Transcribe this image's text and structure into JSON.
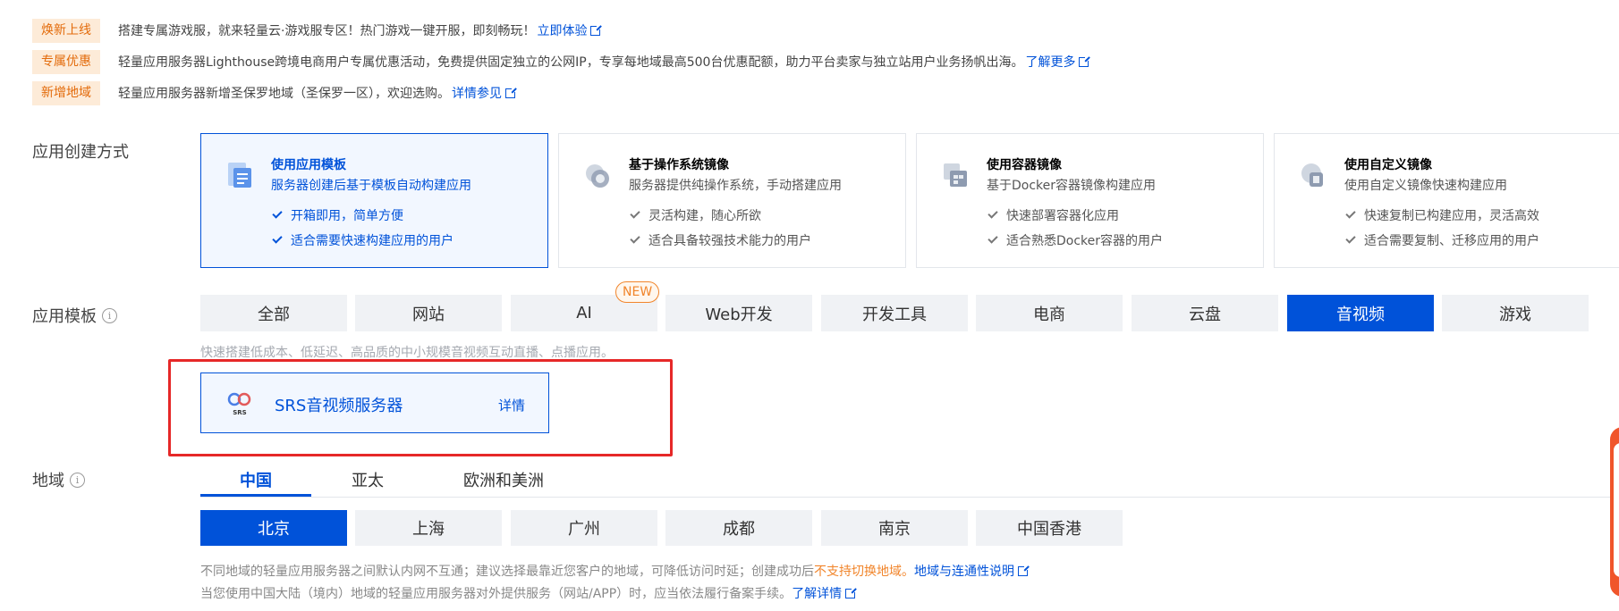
{
  "notices": [
    {
      "tag": "焕新上线",
      "text": "搭建专属游戏服，就来轻量云·游戏服专区！热门游戏一键开服，即刻畅玩！",
      "link": "立即体验"
    },
    {
      "tag": "专属优惠",
      "text": "轻量应用服务器Lighthouse跨境电商用户专属优惠活动，免费提供固定独立的公网IP，专享每地域最高500台优惠配额，助力平台卖家与独立站用户业务扬帆出海。",
      "link": "了解更多"
    },
    {
      "tag": "新增地域",
      "text": "轻量应用服务器新增圣保罗地域（圣保罗一区），欢迎选购。",
      "link": "详情参见"
    }
  ],
  "creation": {
    "label": "应用创建方式",
    "cards": [
      {
        "title": "使用应用模板",
        "desc": "服务器创建后基于模板自动构建应用",
        "features": [
          "开箱即用，简单方便",
          "适合需要快速构建应用的用户"
        ],
        "selected": true
      },
      {
        "title": "基于操作系统镜像",
        "desc": "服务器提供纯操作系统，手动搭建应用",
        "features": [
          "灵活构建，随心所欲",
          "适合具备较强技术能力的用户"
        ],
        "selected": false
      },
      {
        "title": "使用容器镜像",
        "desc": "基于Docker容器镜像构建应用",
        "features": [
          "快速部署容器化应用",
          "适合熟悉Docker容器的用户"
        ],
        "selected": false
      },
      {
        "title": "使用自定义镜像",
        "desc": "使用自定义镜像快速构建应用",
        "features": [
          "快速复制已构建应用，灵活高效",
          "适合需要复制、迁移应用的用户"
        ],
        "selected": false
      }
    ]
  },
  "templates": {
    "label": "应用模板",
    "tabs": [
      "全部",
      "网站",
      "AI",
      "Web开发",
      "开发工具",
      "电商",
      "云盘",
      "音视频",
      "游戏"
    ],
    "active_index": 7,
    "new_badge": "NEW",
    "hint": "快速搭建低成本、低延迟、高品质的中小规模音视频互动直播、点播应用。",
    "app": {
      "name": "SRS音视频服务器",
      "detail": "详情",
      "logo_text": "SRS"
    }
  },
  "region": {
    "label": "地域",
    "tabs": [
      "中国",
      "亚太",
      "欧洲和美洲"
    ],
    "active_tab": 0,
    "cities": [
      "北京",
      "上海",
      "广州",
      "成都",
      "南京",
      "中国香港"
    ],
    "active_city": 0,
    "note1": {
      "before": "不同地域的轻量应用服务器之间默认内网不互通；建议选择最靠近您客户的地域，可降低访问时延；创建成功后",
      "warn": "不支持切换地域。",
      "link": "地域与连通性说明"
    },
    "note2": {
      "text": "当您使用中国大陆（境内）地域的轻量应用服务器对外提供服务（网站/APP）时，应当依法履行备案手续。",
      "link": "了解详情"
    }
  },
  "colors": {
    "primary": "#0052d9",
    "tag_bg": "#fdebd8",
    "tag_text": "#e36b0b",
    "highlight_box": "#e62828",
    "badge": "#f1852b"
  }
}
